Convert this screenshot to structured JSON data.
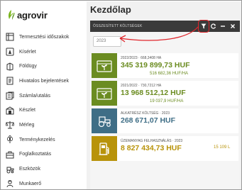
{
  "brand": {
    "name": "agrovir"
  },
  "page": {
    "title": "Kezdőlap"
  },
  "sidebar": {
    "items": [
      {
        "label": "Termesztési időszakok",
        "icon": "season-icon"
      },
      {
        "label": "Kísérlet",
        "icon": "experiment-icon"
      },
      {
        "label": "Földügy",
        "icon": "land-icon"
      },
      {
        "label": "Hivatalos bejelentések",
        "icon": "announcement-icon"
      },
      {
        "label": "Számla/utalás",
        "icon": "invoice-icon"
      },
      {
        "label": "Készlet",
        "icon": "stock-icon"
      },
      {
        "label": "Mérleg",
        "icon": "scale-icon"
      },
      {
        "label": "Terménykezelés",
        "icon": "crop-icon"
      },
      {
        "label": "Foglalkoztatás",
        "icon": "employment-icon"
      },
      {
        "label": "Eszközök",
        "icon": "tractor-icon"
      },
      {
        "label": "Munkaerő",
        "icon": "worker-icon"
      }
    ]
  },
  "widget": {
    "title": "ÖSSZESÍTETT KÖLTSÉGEK",
    "year_value": "2023",
    "cards": [
      {
        "subtitle": "2022/2023 · 668,3408 HA",
        "amount": "345 319 899,73 HUF",
        "secondary": "516 682,36 HUF/HA",
        "icon": "sprout-icon",
        "color": "#6b8c21"
      },
      {
        "subtitle": "2021/2022 · 730,7212 HA",
        "amount": "13 968 512,12 HUF",
        "secondary": "19 037,9 HUF/HA",
        "icon": "sprout-icon",
        "color": "#6b8c21"
      },
      {
        "subtitle": "ALKATRÉSZ KÖLTSÉG · 2023",
        "amount": "268 671,07 HUF",
        "secondary": "",
        "icon": "tractor-icon",
        "color": "#3f6e86"
      },
      {
        "subtitle": "ÜZEMANYAG FELHASZNÁLÁS · 2023",
        "amount": "8 827 434,73 HUF",
        "secondary": "15 109 L",
        "icon": "fuel-pump-icon",
        "color": "#b8930a"
      }
    ]
  },
  "colors": {
    "green": "#6b8c21",
    "blue": "#3f6e86",
    "gold": "#b8930a",
    "annotation": "#e0262c"
  }
}
